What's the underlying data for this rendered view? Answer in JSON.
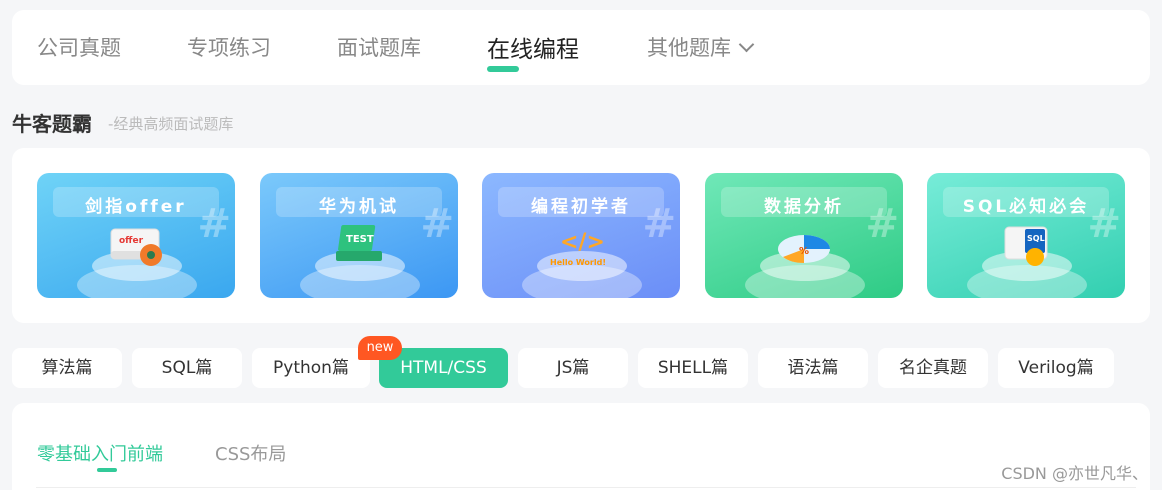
{
  "topnav": {
    "tabs": [
      "公司真题",
      "专项练习",
      "面试题库",
      "在线编程",
      "其他题库"
    ]
  },
  "section": {
    "title": "牛客题霸",
    "subtitle": "-经典高频面试题库"
  },
  "cards": [
    {
      "title": "剑指offer",
      "color": "#3aa7ef"
    },
    {
      "title": "华为机试",
      "color": "#3c97f3"
    },
    {
      "title": "编程初学者",
      "color": "#6b8ef7"
    },
    {
      "title": "数据分析",
      "color": "#2ecb85"
    },
    {
      "title": "SQL必知必会",
      "color": "#32cfb0"
    }
  ],
  "card_art": {
    "book_label": "offer",
    "laptop_label": "TEST",
    "code_symbol": "</>",
    "code_caption": "Hello World!",
    "pie_symbol": "%",
    "sql_label": "SQL"
  },
  "categories": [
    "算法篇",
    "SQL篇",
    "Python篇",
    "HTML/CSS",
    "JS篇",
    "SHELL篇",
    "语法篇",
    "名企真题",
    "Verilog篇"
  ],
  "new_badge": "new",
  "subtabs": [
    "零基础入门前端",
    "CSS布局"
  ],
  "watermark": "CSDN @亦世凡华、",
  "colors": {
    "accent": "#32ca99",
    "badge": "#ff5722"
  }
}
